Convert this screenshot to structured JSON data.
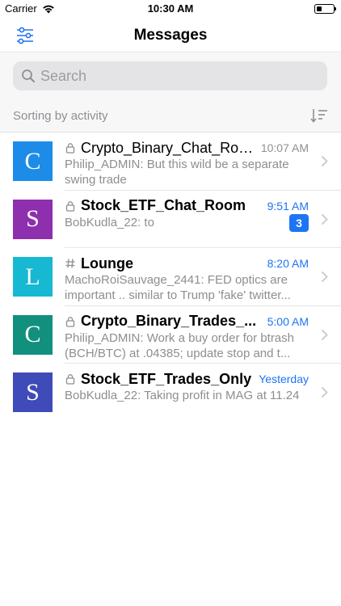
{
  "status_bar": {
    "carrier": "Carrier",
    "time": "10:30 AM",
    "battery_level": 0.3
  },
  "navbar": {
    "title": "Messages",
    "filter_icon": "sliders-icon"
  },
  "search": {
    "placeholder": "Search",
    "value": ""
  },
  "sort": {
    "label": "Sorting by activity",
    "icon": "sort-icon"
  },
  "colors": {
    "accent": "#1d74f5",
    "muted": "#8e8e93",
    "avatar_c1": "#1d8ce8",
    "avatar_s1": "#8e2fae",
    "avatar_l": "#17b8d2",
    "avatar_c2": "#12907e",
    "avatar_s2": "#3f4bb8"
  },
  "rooms": [
    {
      "initial": "C",
      "avatar_color": "#1d8ce8",
      "type": "lock-icon",
      "name": "Crypto_Binary_Chat_Room",
      "bold": false,
      "time": "10:07 AM",
      "time_color": "#8e8e93",
      "preview_line1": "Philip_ADMIN: But this wild be a separate",
      "preview_line2": "swing trade",
      "unread": ""
    },
    {
      "initial": "S",
      "avatar_color": "#8e2fae",
      "type": "lock-icon",
      "name": "Stock_ETF_Chat_Room",
      "bold": true,
      "time": "9:51 AM",
      "time_color": "#1d74f5",
      "preview_line1": "BobKudla_22: to",
      "preview_line2": "",
      "unread": "3"
    },
    {
      "initial": "L",
      "avatar_color": "#17b8d2",
      "type": "hashtag-icon",
      "name": "Lounge",
      "bold": true,
      "time": "8:20 AM",
      "time_color": "#1d74f5",
      "preview_line1": "MachoRoiSauvage_2441: FED optics are",
      "preview_line2": "important .. similar to Trump 'fake' twitter...",
      "unread": ""
    },
    {
      "initial": "C",
      "avatar_color": "#12907e",
      "type": "lock-icon",
      "name": "Crypto_Binary_Trades_...",
      "bold": true,
      "time": "5:00 AM",
      "time_color": "#1d74f5",
      "preview_line1": "Philip_ADMIN: Work a buy order for btrash",
      "preview_line2": "(BCH/BTC)  at .04385; update stop and t...",
      "unread": ""
    },
    {
      "initial": "S",
      "avatar_color": "#3f4bb8",
      "type": "lock-icon",
      "name": "Stock_ETF_Trades_Only",
      "bold": true,
      "time": "Yesterday",
      "time_color": "#1d74f5",
      "preview_line1": "BobKudla_22: Taking profit in MAG at 11.24",
      "preview_line2": "",
      "unread": ""
    }
  ]
}
